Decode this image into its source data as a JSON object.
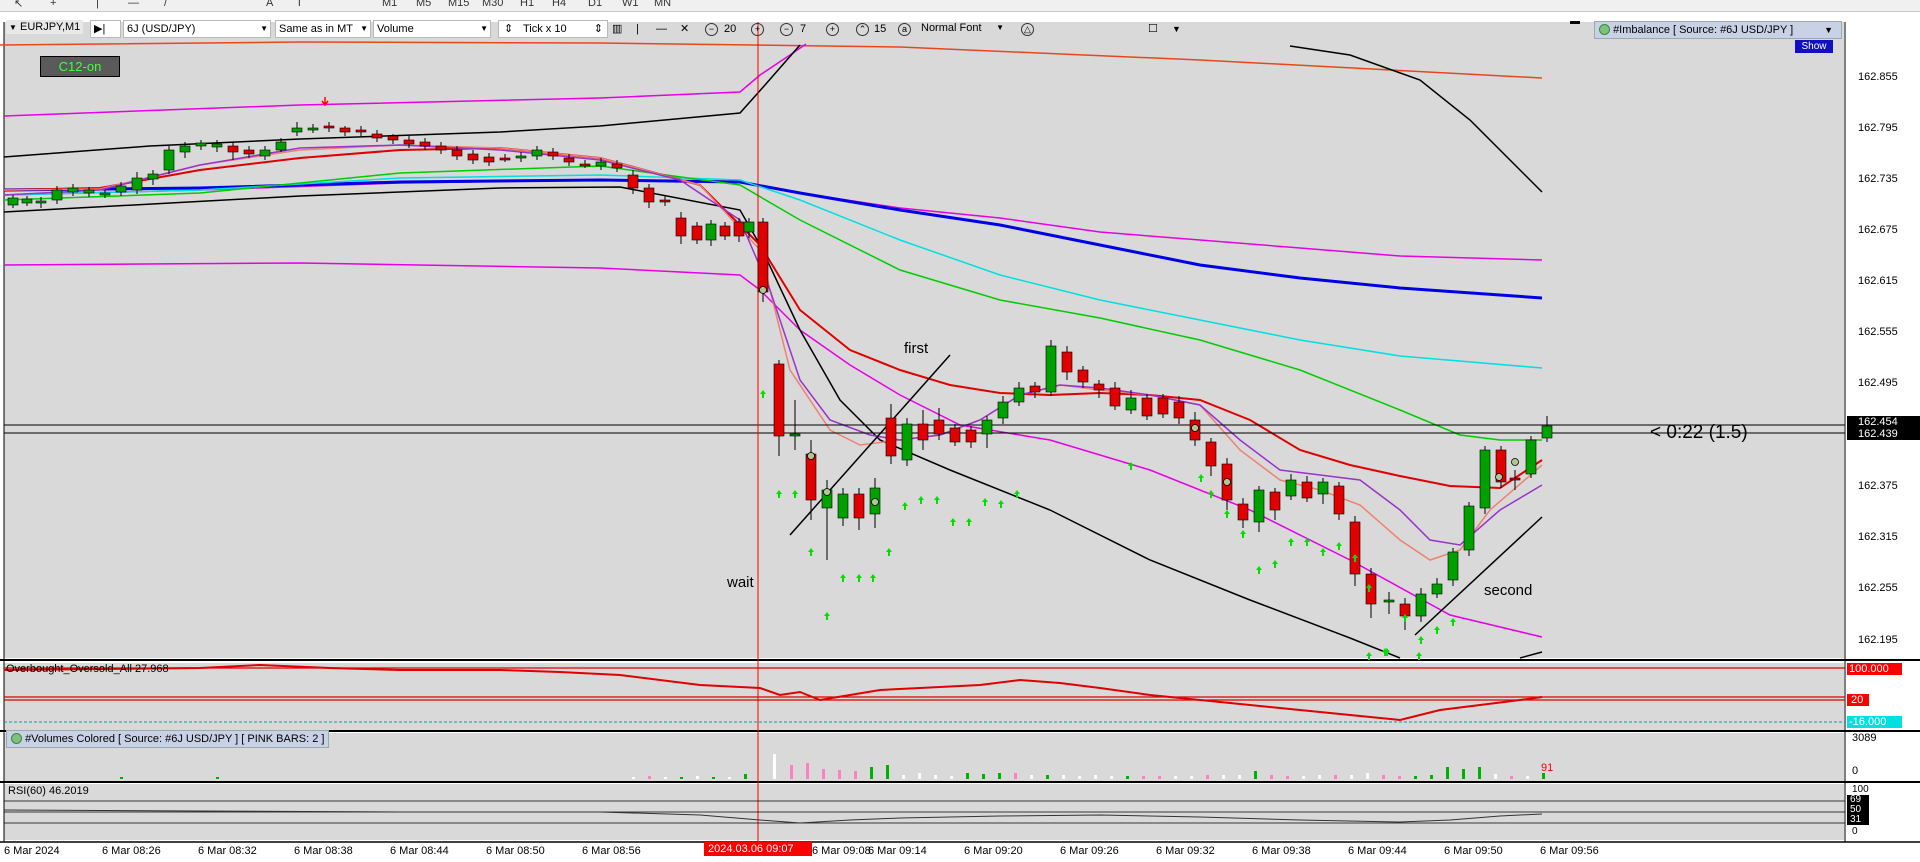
{
  "topbar": {
    "timeframes": [
      "M1",
      "M5",
      "M15",
      "M30",
      "H1",
      "H4",
      "D1",
      "W1",
      "MN"
    ]
  },
  "chart": {
    "symbol_label": "EURJPY,M1",
    "c12_badge": "C12-on",
    "toolbar": {
      "source": "6J (USD/JPY)",
      "mode": "Same as in MT",
      "type": "Volume",
      "tick": "Tick x 10",
      "value_20": "20",
      "value_7": "7",
      "value_15": "15",
      "font": "Normal Font"
    },
    "imbalance": {
      "label": "#Imbalance [ Source: #6J USD/JPY ]",
      "show_button": "Show"
    },
    "price_scale": [
      "162.855",
      "162.795",
      "162.735",
      "162.675",
      "162.615",
      "162.555",
      "162.495",
      "162.375",
      "162.315",
      "162.255",
      "162.195"
    ],
    "price_tags": {
      "ask": "162.454",
      "bid": "162.439"
    },
    "countdown": "< 0:22 (1.5)",
    "annotations": {
      "first": "first",
      "wait": "wait",
      "second": "second"
    }
  },
  "oscillator": {
    "label": "Overbought_Oversold_All 27.968",
    "scale": {
      "top": "100.000",
      "mid": "20",
      "bottom": "-16.000"
    }
  },
  "volumes": {
    "label": "#Volumes Colored [ Source: #6J USD/JPY ]  [ PINK BARS: 2 ]",
    "scale_top": "3089",
    "scale_bottom": "0",
    "last_value": "91"
  },
  "rsi": {
    "label": "RSI(60) 46.2019",
    "scale": [
      "100",
      "69",
      "50",
      "31",
      "0"
    ]
  },
  "time_axis": {
    "labels": [
      "6 Mar 2024",
      "6 Mar 08:26",
      "6 Mar 08:32",
      "6 Mar 08:38",
      "6 Mar 08:44",
      "6 Mar 08:50",
      "6 Mar 08:56",
      "6 Mar 09:08",
      "6 Mar 09:14",
      "6 Mar 09:20",
      "6 Mar 09:26",
      "6 Mar 09:32",
      "6 Mar 09:38",
      "6 Mar 09:44",
      "6 Mar 09:50",
      "6 Mar 09:56"
    ],
    "crosshair_time": "2024.03.06 09:07"
  },
  "colors": {
    "bull": "#00a000",
    "bear": "#e00000",
    "background": "#d9d9d9",
    "accent_red": "#ff0000",
    "crosshair": "#ff0000"
  }
}
